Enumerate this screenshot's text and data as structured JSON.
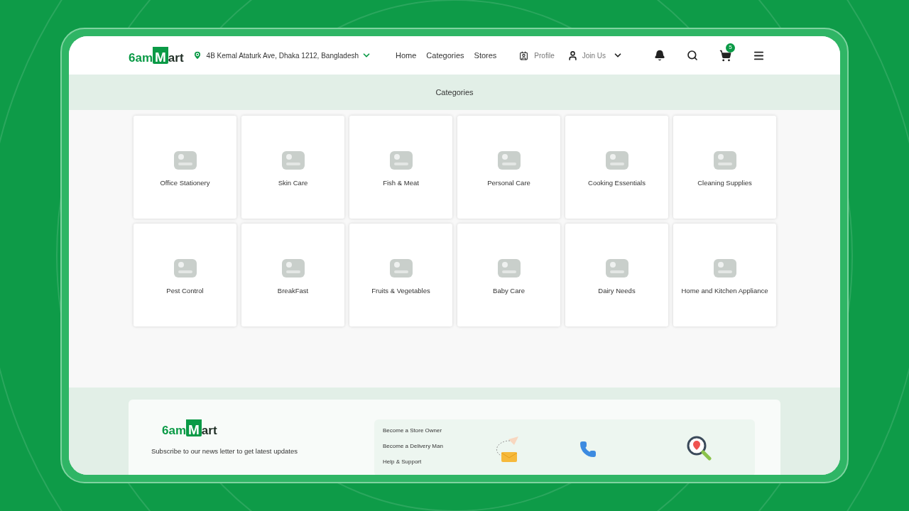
{
  "header": {
    "logo": {
      "part1": "6am",
      "mark": "M",
      "part2": "art"
    },
    "address": "4B Kemal Ataturk Ave, Dhaka 1212, Bangladesh",
    "nav": [
      {
        "label": "Home"
      },
      {
        "label": "Categories"
      },
      {
        "label": "Stores"
      }
    ],
    "profile": "Profile",
    "join": "Join Us",
    "cart_count": "5"
  },
  "banner": {
    "title": "Categories"
  },
  "categories": [
    {
      "name": "Office Stationery"
    },
    {
      "name": "Skin Care"
    },
    {
      "name": "Fish & Meat"
    },
    {
      "name": "Personal Care"
    },
    {
      "name": "Cooking Essentials"
    },
    {
      "name": "Cleaning Supplies"
    },
    {
      "name": "Pest Control"
    },
    {
      "name": "BreakFast"
    },
    {
      "name": "Fruits & Vegetables"
    },
    {
      "name": "Baby Care"
    },
    {
      "name": "Dairy Needs"
    },
    {
      "name": "Home and Kitchen Appliance"
    }
  ],
  "footer": {
    "logo": {
      "part1": "6am",
      "mark": "M",
      "part2": "art"
    },
    "subscribe": "Subscribe to our news letter to get latest updates",
    "links": [
      "Become a Store Owner",
      "Become a Delivery Man",
      "Help & Support"
    ]
  }
}
